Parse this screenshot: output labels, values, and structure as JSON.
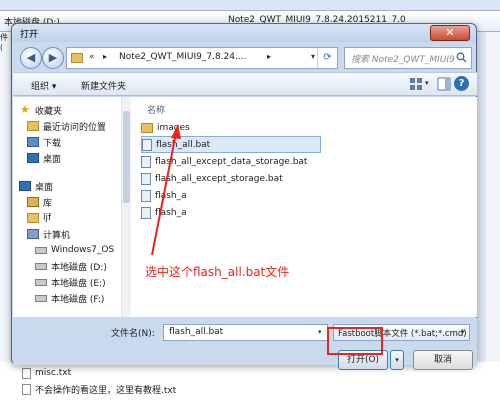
{
  "background": {
    "breadcrumb": [
      "本地磁盘 (D:)",
      "Note2_QWT_MIUI9_7.8.24.2015211_7.0"
    ],
    "left_partial": "件(",
    "files": [
      "misc.txt",
      "不会操作的看这里，这里有教程.txt"
    ]
  },
  "dialog": {
    "title": "打开",
    "close_symbol": "✕",
    "address": {
      "chevron": "«",
      "path": "Note2_QWT_MIUI9_7.8.24....",
      "arrow": "▸"
    },
    "search_placeholder": "搜索 Note2_QWT_MIUI9_7...",
    "toolbar": {
      "organize": "组织 ▾",
      "new_folder": "新建文件夹",
      "help": "?"
    },
    "nav": {
      "favorites": "收藏夹",
      "recent": "最近访问的位置",
      "downloads": "下载",
      "desktop_fav": "桌面",
      "desktop": "桌面",
      "library": "库",
      "user": "ljf",
      "computer": "计算机",
      "drive_c": "Windows7_OS",
      "drive_d": "本地磁盘 (D:)",
      "drive_e": "本地磁盘 (E:)",
      "drive_f": "本地磁盘 (F:)"
    },
    "column_header": "名称",
    "files": [
      "images",
      "flash_all.bat",
      "flash_all_except_data_storage.bat",
      "flash_all_except_storage.bat",
      "flash_a",
      "flash_a"
    ],
    "annotation": "选中这个flash_all.bat文件",
    "filename_label": "文件名(N):",
    "filename_value": "flash_all.bat",
    "file_type": "Fastboot脚本文件 (*.bat;*.cmd)",
    "open_button": "打开(O)",
    "cancel_button": "取消"
  },
  "colors": {
    "annotation_red": "#e8261a",
    "selection": "#dce9f8"
  }
}
